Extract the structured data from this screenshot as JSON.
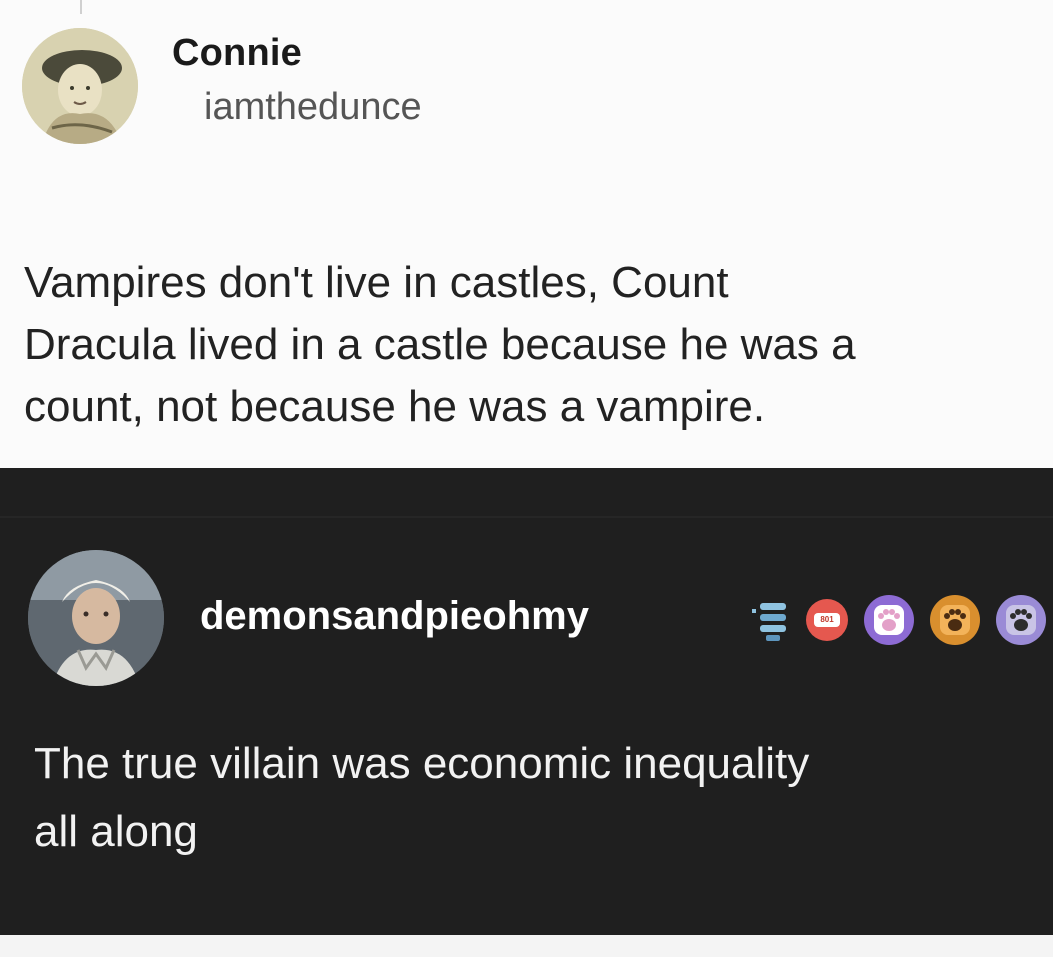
{
  "original_post": {
    "display_name": "Connie",
    "username": "iamthedunce",
    "avatar_icon": "portrait-avatar-icon",
    "text_lines": [
      "Vampires don't live in castles, Count",
      "Dracula lived in a castle because he was a",
      "count, not because he was a vampire."
    ]
  },
  "reply": {
    "username": "demonsandpieohmy",
    "avatar_icon": "portrait-avatar-icon",
    "badges": [
      {
        "icon": "stacked-bars-badge-icon",
        "color": "#8fc3e0"
      },
      {
        "icon": "shield-badge-icon",
        "color": "#e5584f",
        "label": "801"
      },
      {
        "icon": "paw-badge-icon",
        "color": "#8d6bd4"
      },
      {
        "icon": "paw-badge-icon",
        "color": "#d98f2e"
      },
      {
        "icon": "paw-badge-icon",
        "color": "#9a8bd6"
      }
    ],
    "text_lines": [
      "The true villain was economic inequality",
      "all along"
    ]
  },
  "colors": {
    "light_background": "#fbfbfb",
    "dark_background": "#1f1f1f",
    "light_text": "#222222",
    "dark_text": "#f2f2f2"
  }
}
